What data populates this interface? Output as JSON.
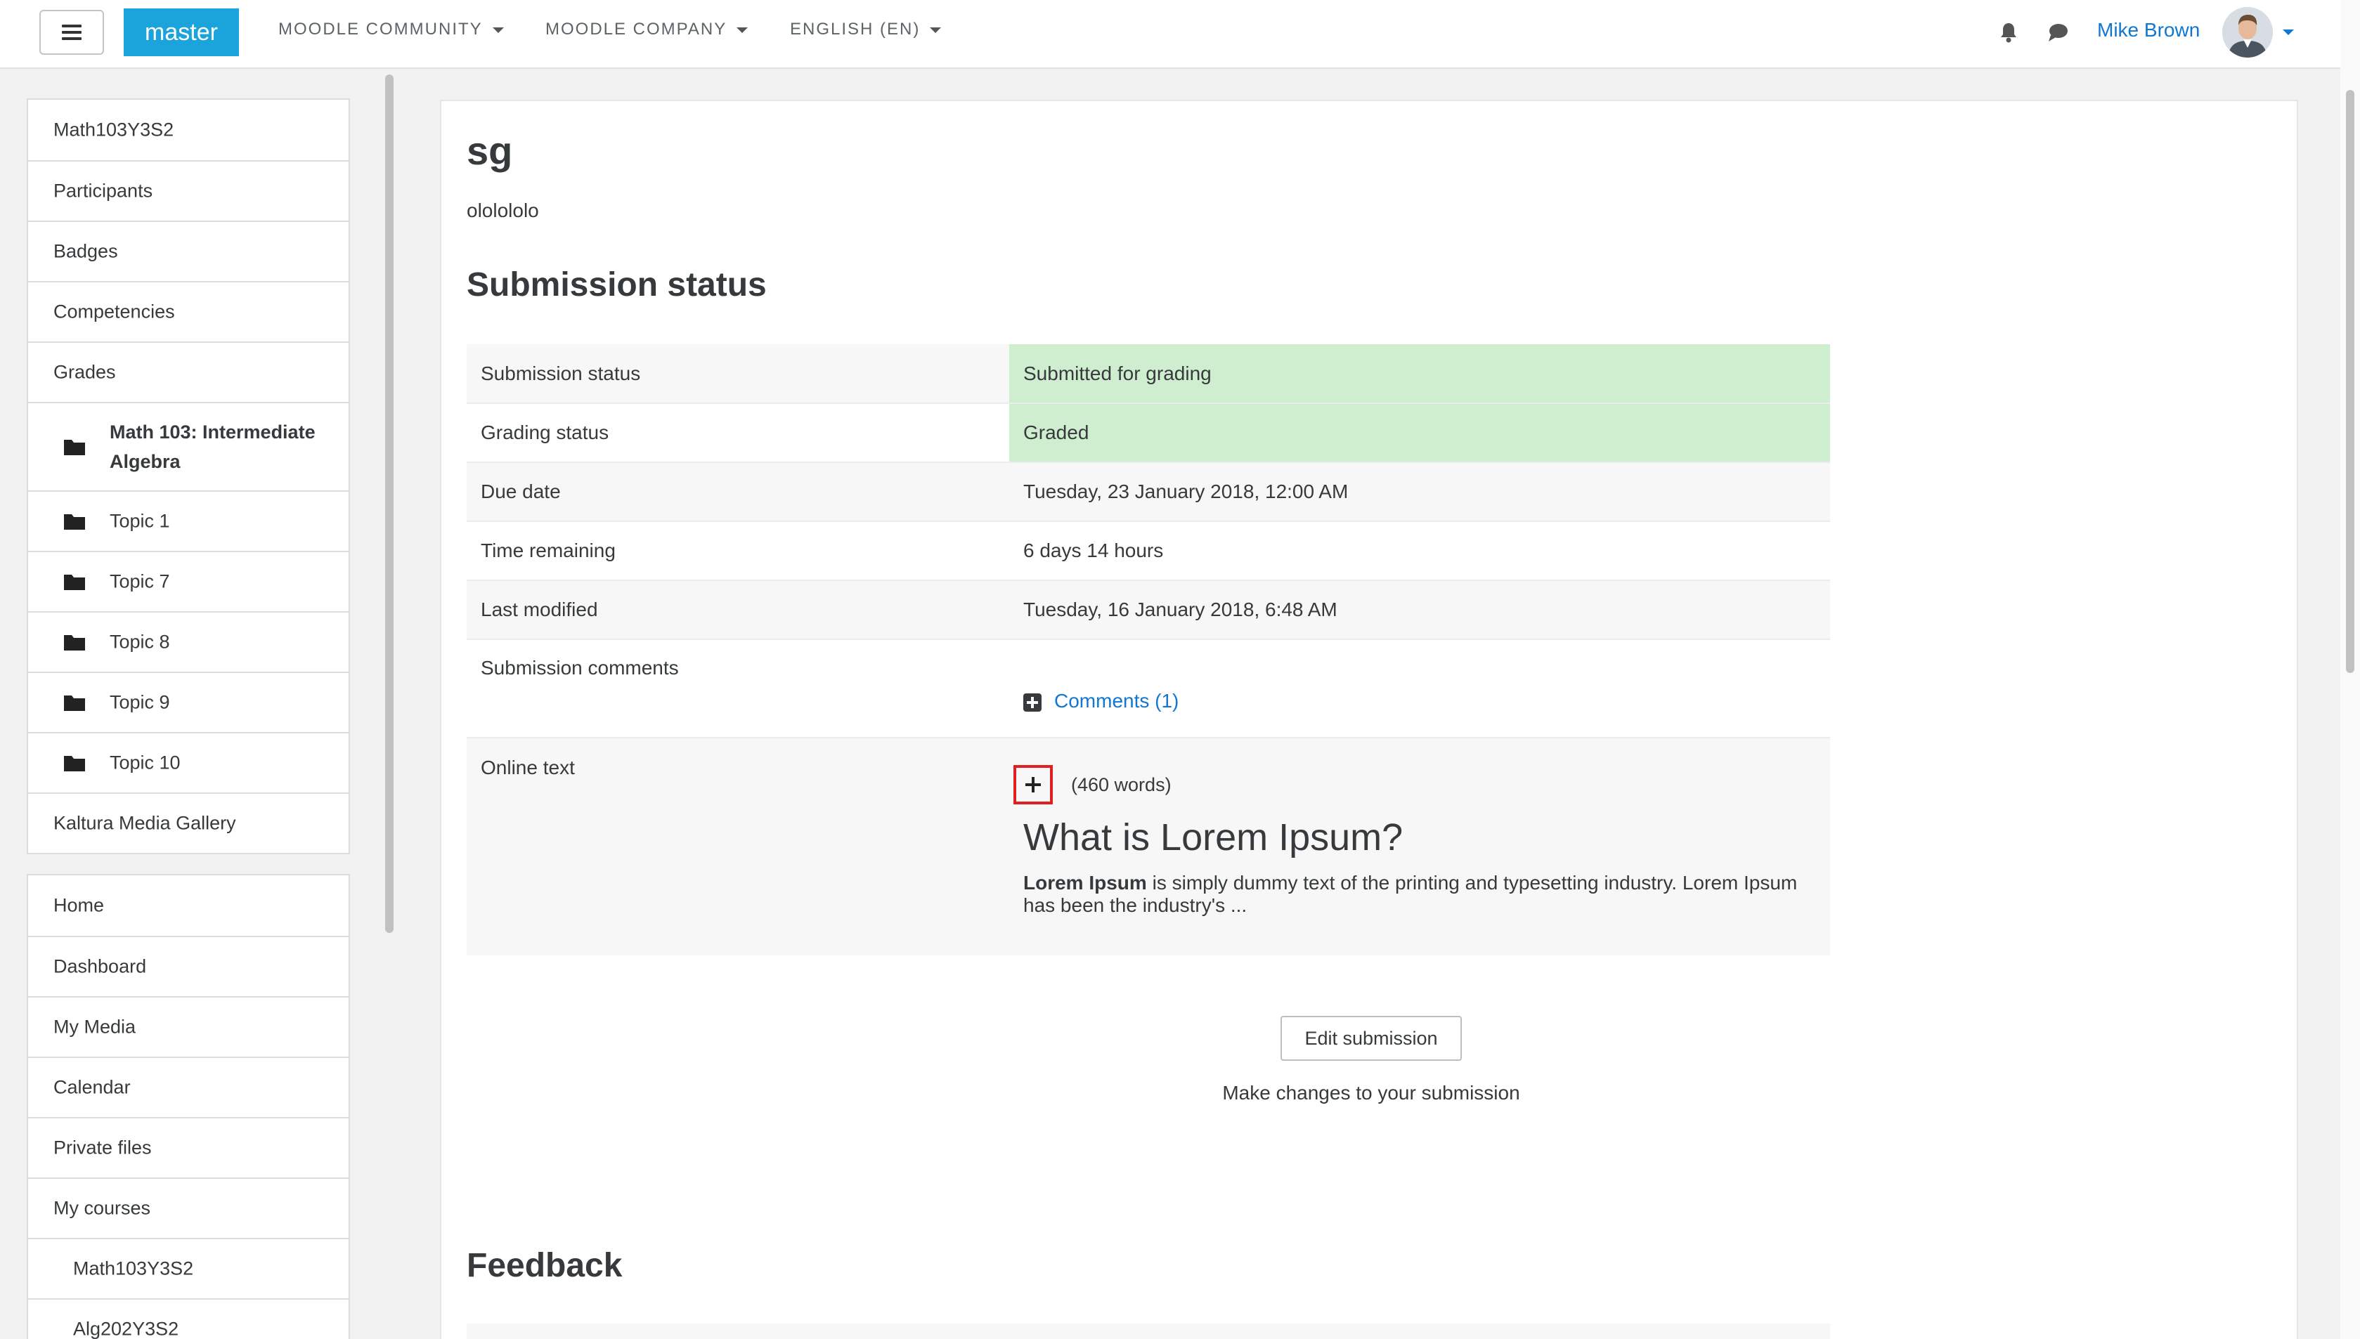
{
  "navbar": {
    "brand": "master",
    "menus": [
      {
        "label": "MOODLE COMMUNITY"
      },
      {
        "label": "MOODLE COMPANY"
      },
      {
        "label": "ENGLISH (EN)"
      }
    ],
    "user_name": "Mike Brown",
    "icons": [
      "hamburger-icon",
      "bell-icon",
      "chat-icon"
    ]
  },
  "sidebar": {
    "course_nav": [
      {
        "label": "Math103Y3S2"
      },
      {
        "label": "Participants"
      },
      {
        "label": "Badges"
      },
      {
        "label": "Competencies"
      },
      {
        "label": "Grades"
      },
      {
        "label": "Math 103: Intermediate Algebra"
      },
      {
        "label": "Topic 1"
      },
      {
        "label": "Topic 7"
      },
      {
        "label": "Topic 8"
      },
      {
        "label": "Topic 9"
      },
      {
        "label": "Topic 10"
      },
      {
        "label": "Kaltura Media Gallery"
      }
    ],
    "site_nav": [
      {
        "label": "Home"
      },
      {
        "label": "Dashboard"
      },
      {
        "label": "My Media"
      },
      {
        "label": "Calendar"
      },
      {
        "label": "Private files"
      },
      {
        "label": "My courses"
      },
      {
        "label": "Math103Y3S2"
      },
      {
        "label": "Alg202Y3S2"
      }
    ]
  },
  "main": {
    "title": "sg",
    "intro": "ololololo",
    "submission_heading": "Submission status",
    "rows": {
      "submission_status": {
        "label": "Submission status",
        "value": "Submitted for grading"
      },
      "grading_status": {
        "label": "Grading status",
        "value": "Graded"
      },
      "due_date": {
        "label": "Due date",
        "value": "Tuesday, 23 January 2018, 12:00 AM"
      },
      "time_remaining": {
        "label": "Time remaining",
        "value": "6 days 14 hours"
      },
      "last_modified": {
        "label": "Last modified",
        "value": "Tuesday, 16 January 2018, 6:48 AM"
      },
      "submission_comments": {
        "label": "Submission comments",
        "value": "Comments (1)"
      },
      "online_text": {
        "label": "Online text",
        "word_count": "(460 words)",
        "heading": "What is Lorem Ipsum?",
        "bold_lead": "Lorem Ipsum",
        "text": " is simply dummy text of the printing and typesetting industry. Lorem Ipsum has been the industry's ..."
      }
    },
    "edit_button": "Edit submission",
    "edit_help": "Make changes to your submission",
    "feedback_heading": "Feedback"
  },
  "colors": {
    "brand": "#1ba4dc",
    "link": "#1177d1",
    "status_positive": "#cfeed0",
    "highlight_border": "#e02020"
  }
}
